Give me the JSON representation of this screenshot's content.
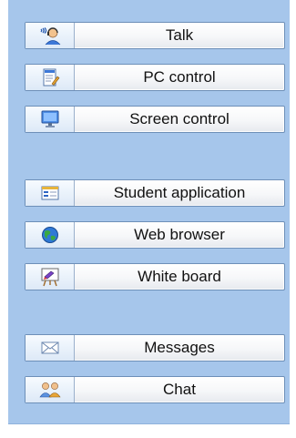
{
  "groups": [
    {
      "buttons": [
        {
          "label": "Talk",
          "icon": "talk-headset-person-icon"
        },
        {
          "label": "PC control",
          "icon": "pc-control-document-pen-icon"
        },
        {
          "label": "Screen control",
          "icon": "screen-monitor-icon"
        }
      ]
    },
    {
      "buttons": [
        {
          "label": "Student application",
          "icon": "student-application-window-icon"
        },
        {
          "label": "Web browser",
          "icon": "web-browser-globe-icon"
        },
        {
          "label": "White board",
          "icon": "whiteboard-easel-icon"
        }
      ]
    },
    {
      "buttons": [
        {
          "label": "Messages",
          "icon": "messages-envelope-icon"
        },
        {
          "label": "Chat",
          "icon": "chat-people-icon"
        }
      ]
    }
  ],
  "colors": {
    "panel_background": "#a6c6eb",
    "button_border": "#6d8fb8",
    "text": "#111111"
  }
}
